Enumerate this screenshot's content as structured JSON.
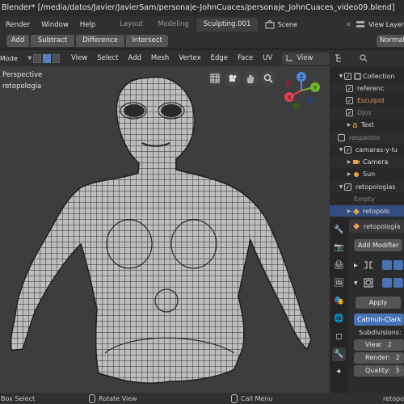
{
  "window": {
    "title": "Blender* [/media/datos/Javier/JavierSam/personaje-JohnCuaces/personaje_JohnCuaces_video09.blend]"
  },
  "topbar": {
    "menus": [
      "Render",
      "Window",
      "Help"
    ],
    "workspaces": [
      "Layout",
      "Modeling",
      "Sculpting.001"
    ],
    "active_workspace": "Sculpting.001",
    "scene": "Scene",
    "view_layer": "View Layer"
  },
  "boolbar": {
    "buttons": [
      "Add",
      "Subtract",
      "Difference",
      "Intersect"
    ],
    "normal": "Normal"
  },
  "viewport_header": {
    "mode": "Mode",
    "menus": [
      "View",
      "Select",
      "Add",
      "Mesh",
      "Vertex",
      "Edge",
      "Face",
      "UV"
    ],
    "view_dropdown": "View"
  },
  "viewport": {
    "perspective": "Perspective",
    "object": "retopología",
    "gizmo_axes": [
      "Z",
      "Y",
      "X"
    ]
  },
  "outliner": {
    "rows": [
      "Collection",
      "referenc",
      "Esculpid",
      "Ojos",
      "Text",
      "respaldos",
      "camaras-y-lu",
      "Camera",
      "Sun",
      "retopologías",
      "Empty",
      "retopolo"
    ]
  },
  "properties": {
    "object_name": "retopología",
    "add_modifier": "Add Modifier",
    "apply": "Apply",
    "subdiv_type": "Catmull-Clark",
    "subdivisions_label": "Subdivisions:",
    "fields": [
      {
        "label": "View:",
        "value": "2"
      },
      {
        "label": "Render:",
        "value": "2"
      },
      {
        "label": "Quality:",
        "value": "3"
      }
    ]
  },
  "statusbar": {
    "items": [
      "Box Select",
      "Rotate View",
      "Call Menu"
    ],
    "right": "retopo"
  },
  "colors": {
    "accent": "#4772b3",
    "selected_row": "#334d80",
    "orange": "#e5a050"
  }
}
